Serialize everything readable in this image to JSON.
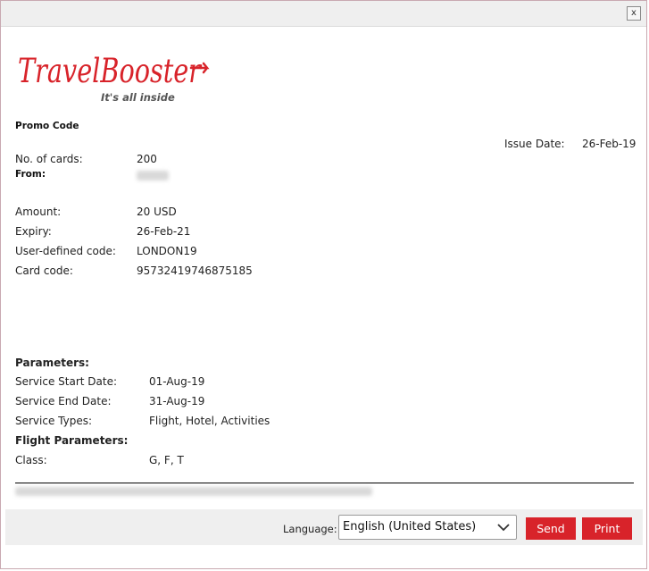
{
  "window": {
    "close_label": "x"
  },
  "logo": {
    "brand": "TravelBooster",
    "tagline": "It's all inside",
    "brand_color": "#d8232a",
    "tagline_color": "#555555"
  },
  "header": {
    "title": "Promo Code",
    "issue_date_label": "Issue Date:",
    "issue_date": "26-Feb-19"
  },
  "card": {
    "count_label": "No. of cards:",
    "count": "200",
    "from_label": "From:",
    "amount_label": "Amount:",
    "amount": "20 USD",
    "expiry_label": "Expiry:",
    "expiry": "26-Feb-21",
    "user_code_label": "User-defined code:",
    "user_code": "LONDON19",
    "card_code_label": "Card code:",
    "card_code": "95732419746875185"
  },
  "parameters": {
    "heading": "Parameters:",
    "start_label": "Service Start Date:",
    "start": "01-Aug-19",
    "end_label": "Service End Date:",
    "end": "31-Aug-19",
    "types_label": "Service Types:",
    "types": "Flight, Hotel, Activities",
    "flight_heading": "Flight Parameters:",
    "class_label": "Class:",
    "class": "G, F, T"
  },
  "footer": {
    "language_label": "Language:",
    "language_value": "English (United States)",
    "send_label": "Send",
    "print_label": "Print",
    "button_color": "#d8232a"
  }
}
